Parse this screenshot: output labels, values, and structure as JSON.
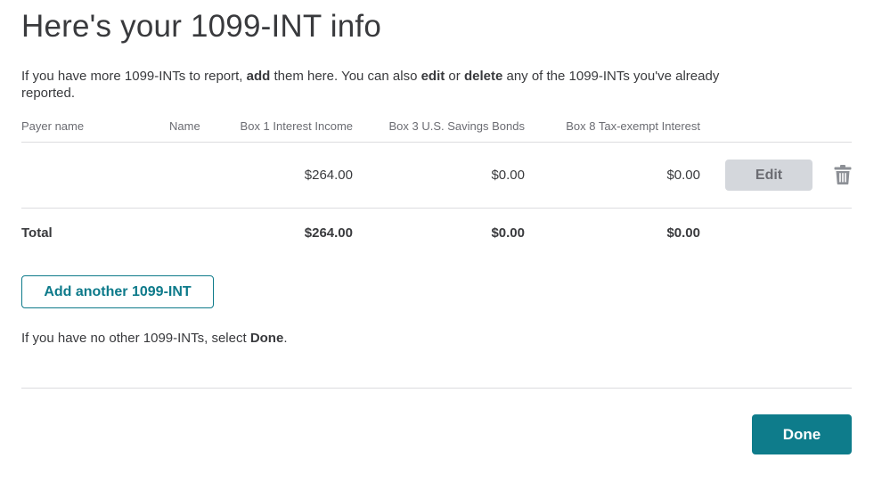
{
  "page_title": "Here's your 1099-INT info",
  "intro": {
    "part1": "If you have more 1099-INTs to report, ",
    "add_word": "add",
    "part2": " them here. You can also ",
    "edit_word": "edit",
    "part3": " or ",
    "delete_word": "delete",
    "part4": " any of the 1099-INTs you've already reported."
  },
  "table": {
    "headers": {
      "payer_name": "Payer name",
      "name": "Name",
      "box1": "Box 1 Interest Income",
      "box3": "Box 3 U.S. Savings Bonds",
      "box8": "Box 8 Tax-exempt Interest"
    },
    "rows": [
      {
        "payer_name": "",
        "name": "",
        "box1": "$264.00",
        "box3": "$0.00",
        "box8": "$0.00",
        "edit_label": "Edit",
        "delete_icon": "trash-icon"
      }
    ],
    "total": {
      "label": "Total",
      "box1": "$264.00",
      "box3": "$0.00",
      "box8": "$0.00"
    }
  },
  "add_button_label": "Add another 1099-INT",
  "note": {
    "part1": "If you have no other 1099-INTs, select ",
    "done_word": "Done",
    "part2": "."
  },
  "done_button_label": "Done",
  "colors": {
    "accent": "#0e7c8b",
    "text": "#393a3d",
    "muted": "#6b6c72",
    "edit_bg": "#d4d7dc",
    "divider": "#dcdcdf"
  }
}
